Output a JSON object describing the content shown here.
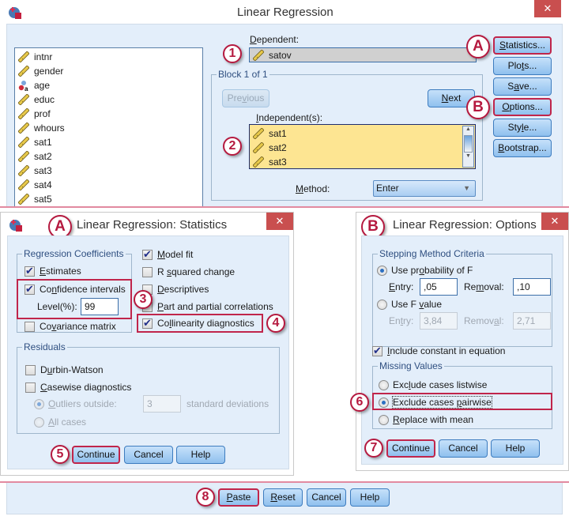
{
  "main_dialog": {
    "title": "Linear Regression",
    "close_icon": "close-icon",
    "source_variables": [
      {
        "name": "intnr",
        "icon": "scale-ruler-icon"
      },
      {
        "name": "gender",
        "icon": "scale-ruler-icon"
      },
      {
        "name": "age",
        "icon": "nominal-string-icon"
      },
      {
        "name": "educ",
        "icon": "scale-ruler-icon"
      },
      {
        "name": "prof",
        "icon": "scale-ruler-icon"
      },
      {
        "name": "whours",
        "icon": "scale-ruler-icon"
      },
      {
        "name": "sat1",
        "icon": "scale-ruler-icon"
      },
      {
        "name": "sat2",
        "icon": "scale-ruler-icon"
      },
      {
        "name": "sat3",
        "icon": "scale-ruler-icon"
      },
      {
        "name": "sat4",
        "icon": "scale-ruler-icon"
      },
      {
        "name": "sat5",
        "icon": "scale-ruler-icon"
      }
    ],
    "dependent_label": "Dependent:",
    "dependent_value": "satov",
    "block_label": "Block 1 of 1",
    "previous_label": "Previous",
    "next_label": "Next",
    "independents_label": "Independent(s):",
    "independents": [
      "sat1",
      "sat2",
      "sat3"
    ],
    "method_label": "Method:",
    "method_value": "Enter",
    "side_buttons": [
      "Statistics...",
      "Plots...",
      "Save...",
      "Options...",
      "Style...",
      "Bootstrap..."
    ],
    "bottom_buttons": [
      "Paste",
      "Reset",
      "Cancel",
      "Help"
    ]
  },
  "statistics_dialog": {
    "title": "Linear Regression: Statistics",
    "regression_coefficients_label": "Regression Coefficients",
    "estimates": {
      "label": "Estimates",
      "checked": true
    },
    "confidence_intervals": {
      "label": "Confidence intervals",
      "checked": true
    },
    "level_label": "Level(%):",
    "level_value": "99",
    "covariance_matrix": {
      "label": "Covariance matrix",
      "checked": false
    },
    "model_fit": {
      "label": "Model fit",
      "checked": true
    },
    "r_squared_change": {
      "label": "R squared change",
      "checked": false
    },
    "descriptives": {
      "label": "Descriptives",
      "checked": false
    },
    "part_partial": {
      "label": "Part and partial correlations",
      "checked": false
    },
    "collinearity": {
      "label": "Collinearity diagnostics",
      "checked": true
    },
    "residuals_label": "Residuals",
    "durbin_watson": {
      "label": "Durbin-Watson",
      "checked": false
    },
    "casewise": {
      "label": "Casewise diagnostics",
      "checked": false
    },
    "outliers_label": "Outliers outside:",
    "outliers_value": "3",
    "std_dev_label": "standard deviations",
    "all_cases_label": "All cases",
    "buttons": [
      "Continue",
      "Cancel",
      "Help"
    ]
  },
  "options_dialog": {
    "title": "Linear Regression: Options",
    "stepping_label": "Stepping Method Criteria",
    "use_probability_label": "Use probability of F",
    "entry_label": "Entry:",
    "entry_value": ",05",
    "removal_label": "Removal:",
    "removal_value": ",10",
    "use_f_value_label": "Use F value",
    "f_entry_label": "Entry:",
    "f_entry_value": "3,84",
    "f_removal_label": "Removal:",
    "f_removal_value": "2,71",
    "include_constant": {
      "label": "Include constant in equation",
      "checked": true
    },
    "missing_values_label": "Missing Values",
    "missing_options": [
      "Exclude cases listwise",
      "Exclude cases pairwise",
      "Replace with mean"
    ],
    "missing_selected": "Exclude cases pairwise",
    "buttons": [
      "Continue",
      "Cancel",
      "Help"
    ]
  },
  "annotations": {
    "badges": [
      "1",
      "2",
      "A",
      "B",
      "3",
      "4",
      "5",
      "6",
      "7",
      "8"
    ]
  },
  "colors": {
    "highlight": "#c0254b",
    "panel_bg": "#e3eefa",
    "independent_bg": "#fde592",
    "close_red": "#c94f4f"
  }
}
